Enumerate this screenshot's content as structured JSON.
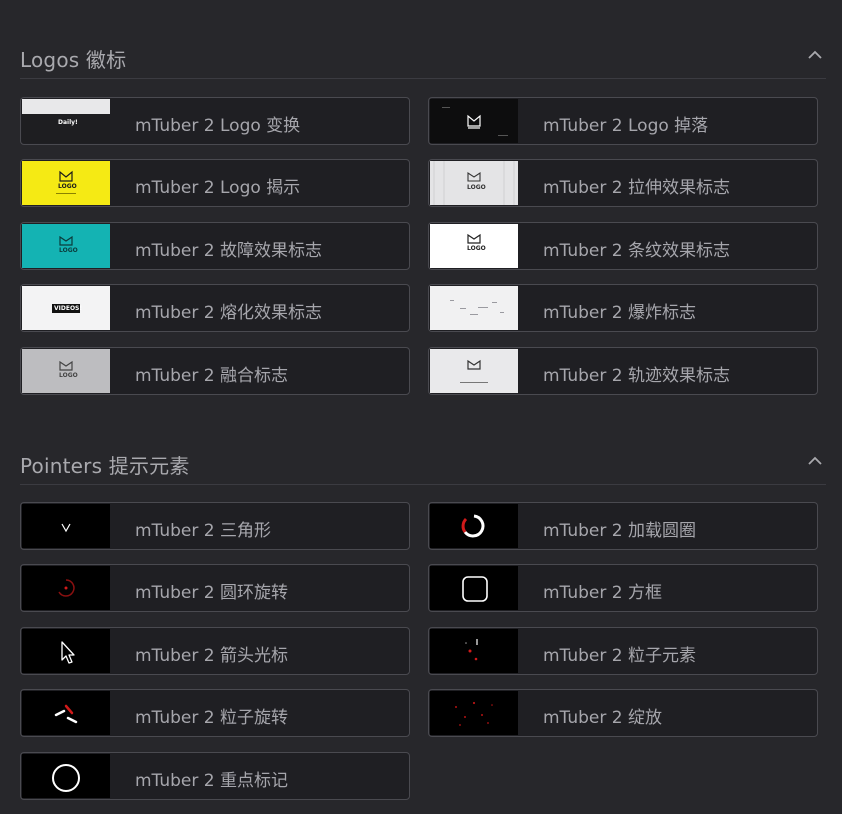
{
  "sections": [
    {
      "title": "Logos 徽标",
      "items": [
        {
          "label": "mTuber 2 Logo 变换",
          "thumb_text": "Daily!"
        },
        {
          "label": "mTuber 2 Logo 掉落"
        },
        {
          "label": "mTuber 2 Logo 揭示",
          "thumb_text": "LOGO"
        },
        {
          "label": "mTuber 2 拉伸效果标志",
          "thumb_text": "LOGO"
        },
        {
          "label": "mTuber 2 故障效果标志",
          "thumb_text": "LOGO"
        },
        {
          "label": "mTuber 2 条纹效果标志",
          "thumb_text": "LOGO"
        },
        {
          "label": "mTuber 2 熔化效果标志",
          "thumb_text": "VIDEOS!"
        },
        {
          "label": "mTuber 2 爆炸标志"
        },
        {
          "label": "mTuber 2 融合标志",
          "thumb_text": "LOGO"
        },
        {
          "label": "mTuber 2 轨迹效果标志"
        }
      ]
    },
    {
      "title": "Pointers 提示元素",
      "items": [
        {
          "label": "mTuber 2 三角形"
        },
        {
          "label": "mTuber 2 加载圆圈"
        },
        {
          "label": "mTuber 2 圆环旋转"
        },
        {
          "label": "mTuber 2 方框"
        },
        {
          "label": "mTuber 2 箭头光标"
        },
        {
          "label": "mTuber 2 粒子元素"
        },
        {
          "label": "mTuber 2 粒子旋转"
        },
        {
          "label": "mTuber 2 绽放"
        },
        {
          "label": "mTuber 2 重点标记"
        }
      ]
    }
  ],
  "colors": {
    "background": "#27272b",
    "card": "#1f1f23",
    "card_border": "#4a4a50",
    "text": "#a6a6ac",
    "accent_red": "#d11a1a",
    "yellow": "#f5ea14",
    "teal": "#14b3b3"
  }
}
